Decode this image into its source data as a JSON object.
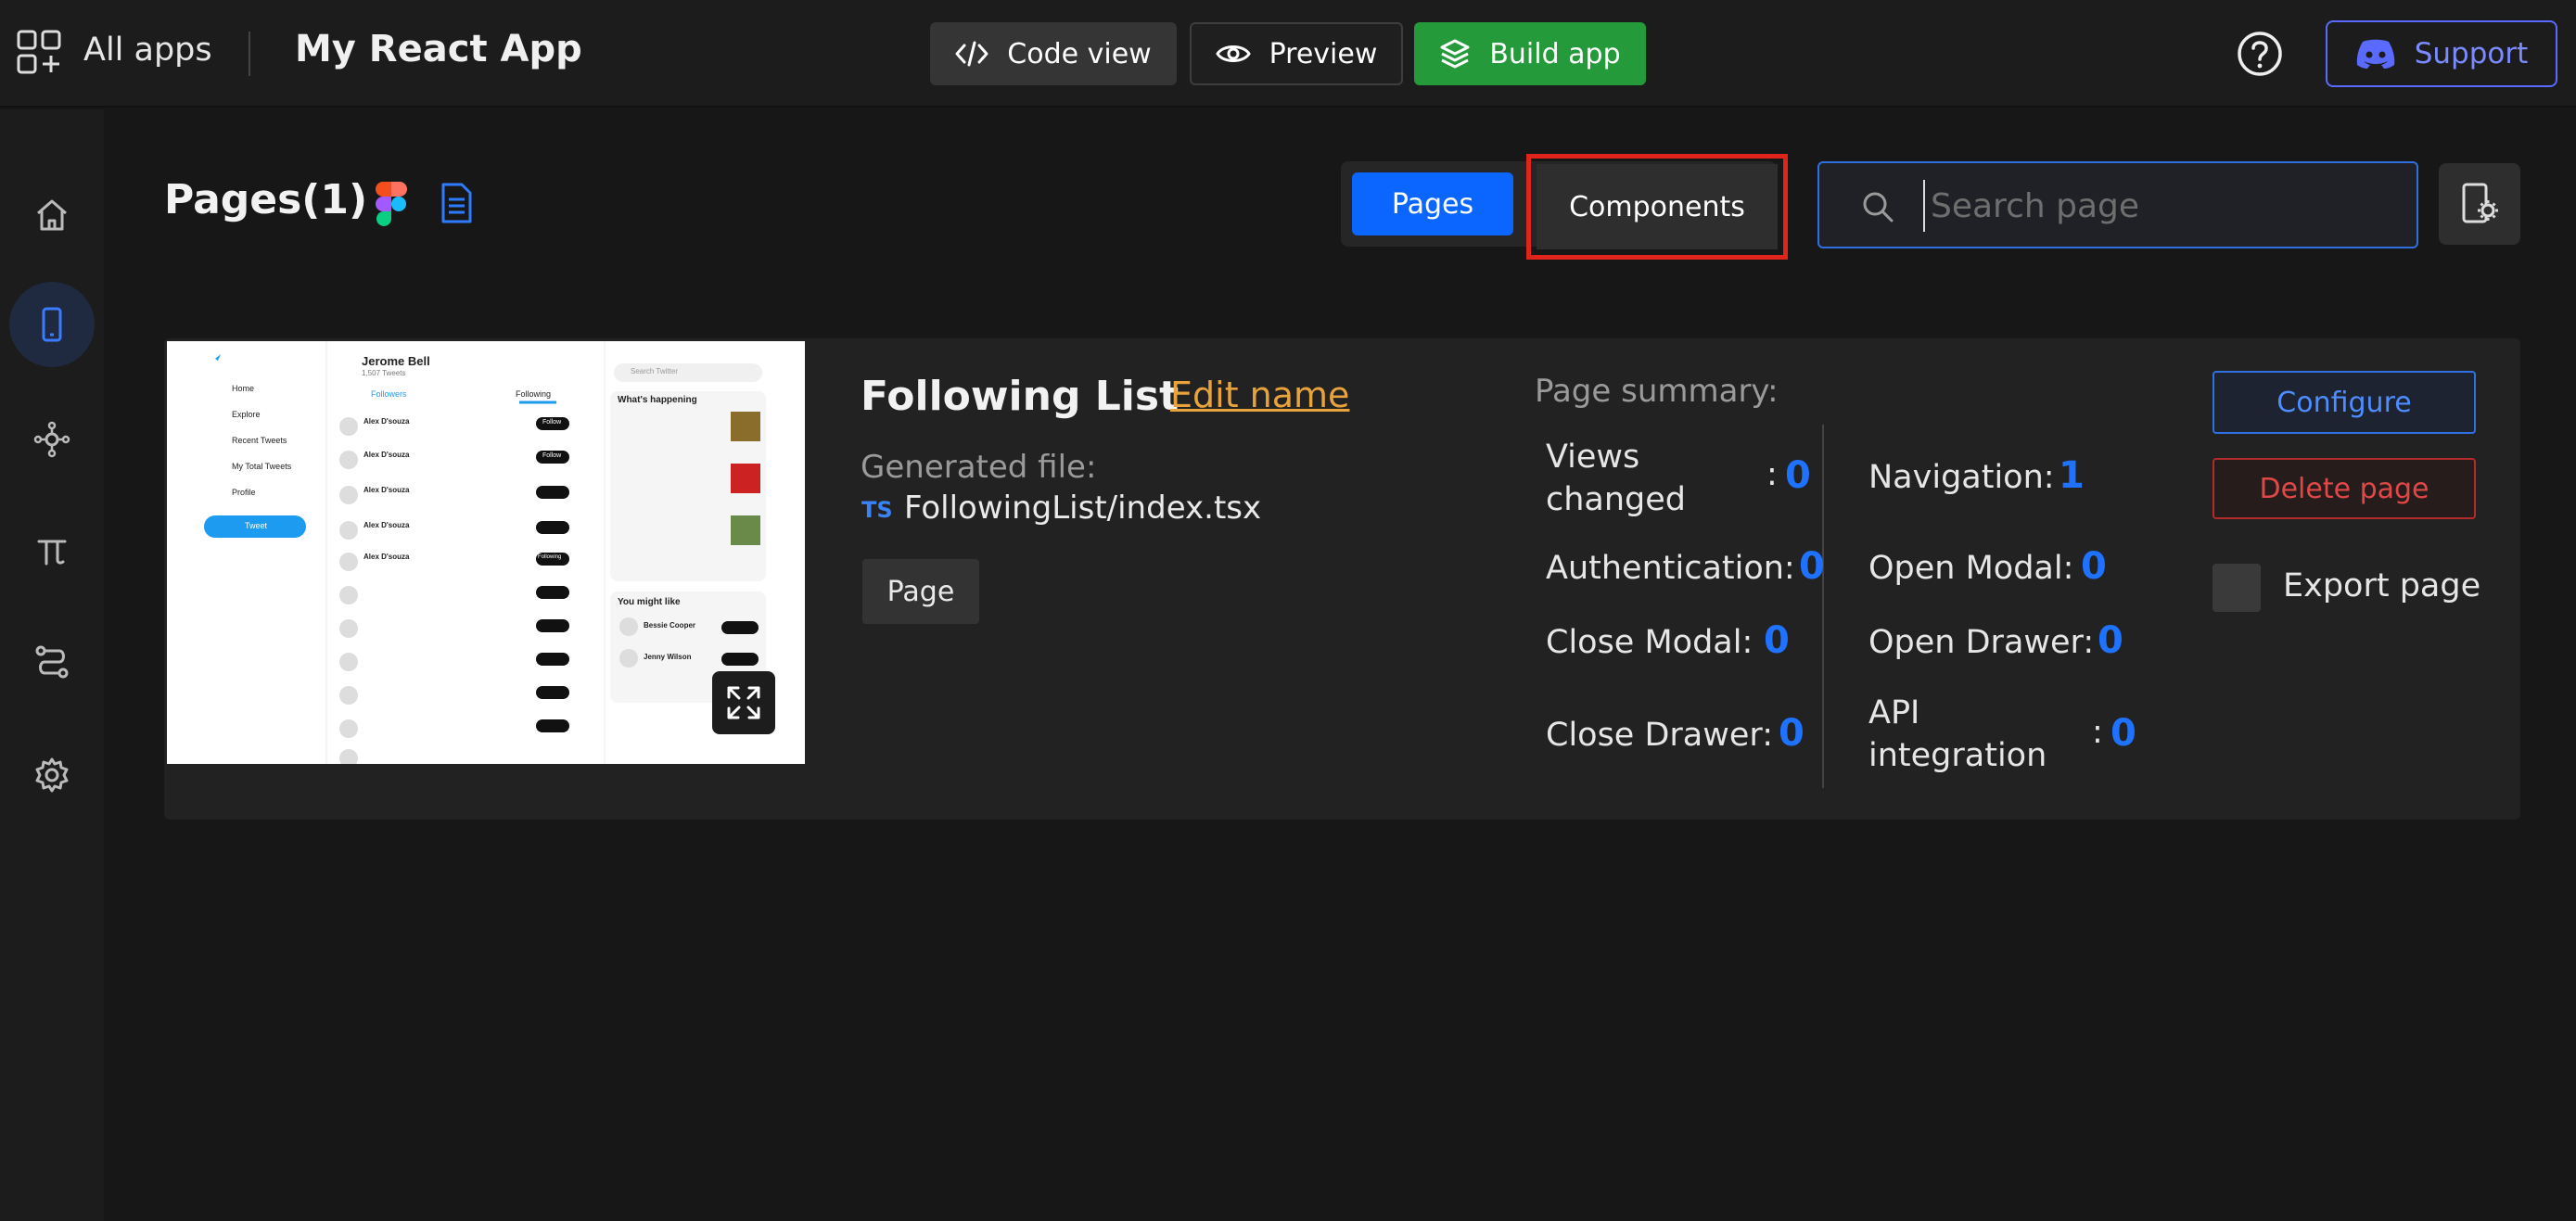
{
  "topbar": {
    "all_apps": "All apps",
    "app_title": "My React App",
    "code_view": "Code view",
    "preview": "Preview",
    "build_app": "Build app",
    "support": "Support"
  },
  "sidebar": {
    "items": [
      {
        "icon": "home-icon"
      },
      {
        "icon": "mobile-icon",
        "active": true
      },
      {
        "icon": "components-icon"
      },
      {
        "icon": "pi-icon"
      },
      {
        "icon": "flow-icon"
      },
      {
        "icon": "settings-icon"
      }
    ]
  },
  "header": {
    "pages_title": "Pages(1)",
    "pages_tab": "Pages",
    "components_tab": "Components",
    "search_placeholder": "Search page"
  },
  "page": {
    "name": "Following List",
    "edit_name": "Edit name",
    "generated_label": "Generated file:",
    "ts_badge": "TS",
    "generated_file": "FollowingList/index.tsx",
    "type_chip": "Page",
    "summary_label": "Page summary:",
    "stats": {
      "views_changed_label": "Views changed",
      "views_changed": "0",
      "navigation_label": "Navigation:",
      "navigation": "1",
      "authentication_label": "Authentication:",
      "authentication": "0",
      "open_modal_label": "Open Modal:",
      "open_modal": "0",
      "close_modal_label": "Close Modal:",
      "close_modal": "0",
      "open_drawer_label": "Open Drawer:",
      "open_drawer": "0",
      "close_drawer_label": "Close Drawer:",
      "close_drawer": "0",
      "api_label": "API integration",
      "api": "0"
    },
    "configure": "Configure",
    "delete": "Delete page",
    "export": "Export page"
  },
  "thumbnail": {
    "profile_name": "Jerome Bell",
    "tweets": "1,507 Tweets",
    "tab_followers": "Followers",
    "tab_following": "Following",
    "nav": [
      "Home",
      "Explore",
      "Recent Tweets",
      "My Total Tweets",
      "Profile"
    ],
    "tweet_btn": "Tweet",
    "search": "Search Twitter",
    "happening": "What's happening",
    "might_like": "You might like",
    "suggest": [
      "Bessie Cooper",
      "Jenny Wilson"
    ],
    "row_name": "Alex D'souza",
    "follow": "Follow",
    "following": "Following"
  },
  "colors": {
    "accent_blue": "#0b66ff",
    "build_green": "#249a3a",
    "highlight_red": "#e0241b",
    "edit_orange": "#e8a33c",
    "support_purple": "#5a6aff"
  }
}
